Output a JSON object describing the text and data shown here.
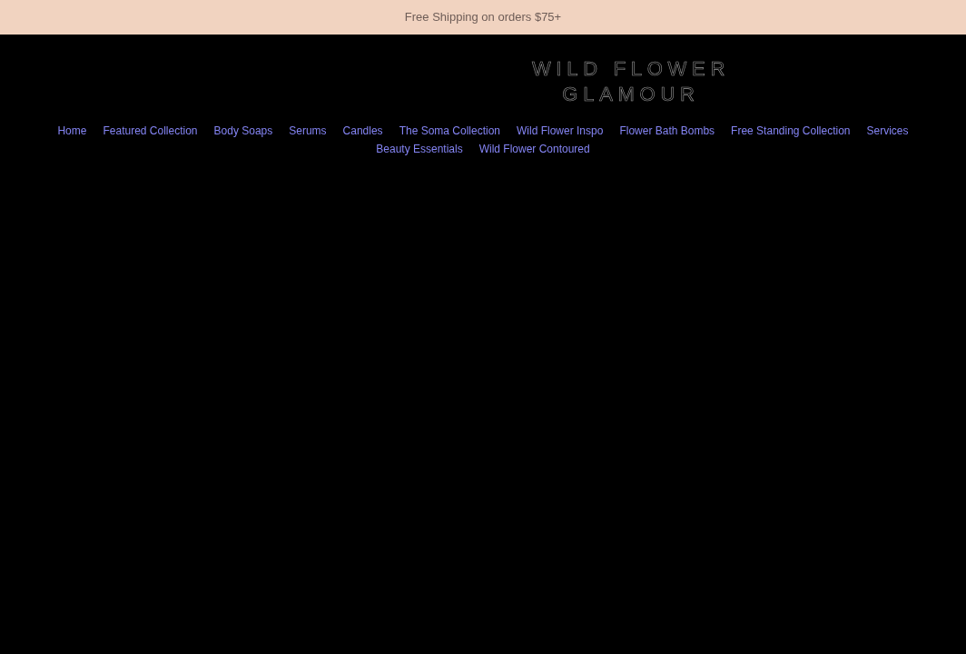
{
  "announcement_bar": {
    "text": "Free Shipping on orders $75+"
  },
  "logo": {
    "lines": [
      "WILD FLOWER",
      "GLAMOUR"
    ]
  },
  "nav": {
    "items": [
      {
        "label": "Home"
      },
      {
        "label": "Featured Collection"
      },
      {
        "label": "Body Soaps"
      },
      {
        "label": "Serums"
      },
      {
        "label": "Candles"
      },
      {
        "label": "The Soma Collection"
      },
      {
        "label": "Wild Flower Inspo"
      },
      {
        "label": "Flower Bath Bombs"
      },
      {
        "label": "Free Standing Collection"
      },
      {
        "label": "Services"
      },
      {
        "label": "Beauty Essentials"
      },
      {
        "label": "Wild Flower Contoured"
      }
    ]
  }
}
